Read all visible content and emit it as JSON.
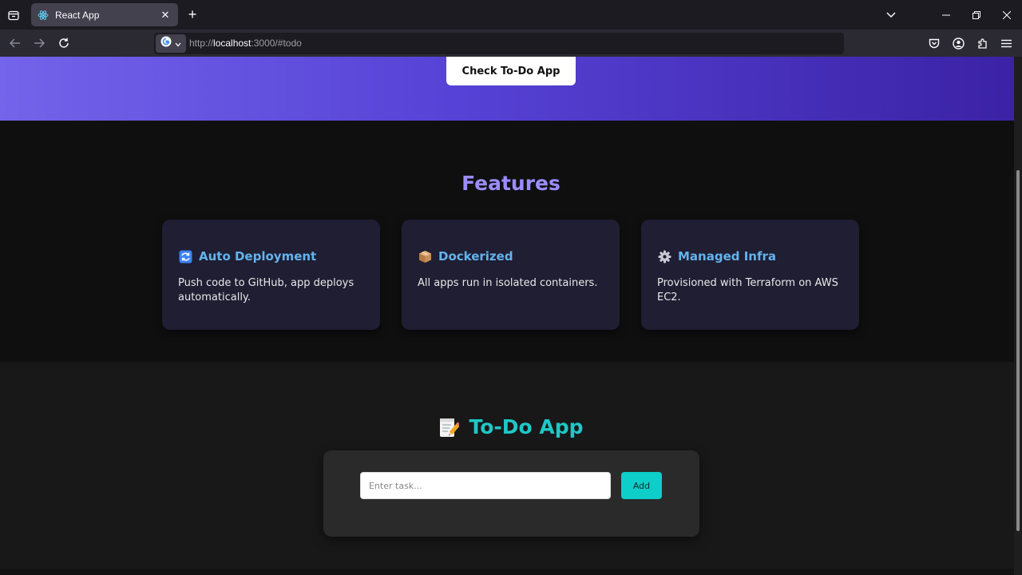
{
  "browser": {
    "tab_title": "React App",
    "url_scheme": "http://",
    "url_host": "localhost",
    "url_rest": ":3000/#todo",
    "icons": [
      "tab-list-icon",
      "react-icon",
      "close-icon",
      "plus-icon",
      "chevron-down-icon",
      "minimize-icon",
      "restore-icon",
      "close-window-icon",
      "back-arrow-icon",
      "forward-arrow-icon",
      "reload-icon",
      "google-icon",
      "pocket-icon",
      "account-icon",
      "extensions-icon",
      "menu-icon"
    ]
  },
  "hero": {
    "button_label": "Check To-Do App"
  },
  "features": {
    "heading": "Features",
    "cards": [
      {
        "icon": "refresh-icon",
        "title": "Auto Deployment",
        "description": "Push code to GitHub, app deploys automatically."
      },
      {
        "icon": "package-icon",
        "title": "Dockerized",
        "description": "All apps run in isolated containers."
      },
      {
        "icon": "gear-icon",
        "title": "Managed Infra",
        "description": "Provisioned with Terraform on AWS EC2."
      }
    ]
  },
  "todo": {
    "heading": "To-Do App",
    "heading_icon": "memo-icon",
    "input_value": "",
    "input_placeholder": "Enter task...",
    "add_label": "Add"
  },
  "colors": {
    "accent_purple": "#9b8cff",
    "card_title_blue": "#63b3ed",
    "todo_teal": "#1fc7c7",
    "add_button": "#0ecec9"
  }
}
